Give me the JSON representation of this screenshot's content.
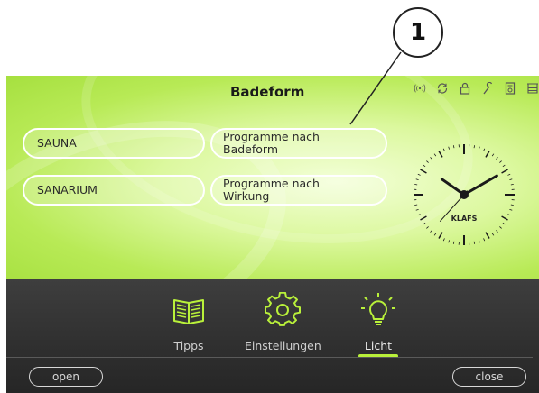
{
  "callout": {
    "number": "1"
  },
  "screen": {
    "title": "Badeform",
    "status_icons": [
      "wireless-icon",
      "refresh-icon",
      "lock-icon",
      "wrench-icon",
      "device-icon",
      "stack-icon"
    ],
    "buttons": [
      {
        "label": "SAUNA"
      },
      {
        "label_line1": "Programme nach",
        "label_line2": "Badeform"
      },
      {
        "label": "SANARIUM"
      },
      {
        "label_line1": "Programme nach",
        "label_line2": "Wirkung"
      }
    ],
    "clock": {
      "brand": "KLAFS",
      "hour": 10,
      "minute": 10,
      "second": 37
    }
  },
  "nav": {
    "items": [
      {
        "label": "Tipps",
        "icon": "book-icon"
      },
      {
        "label": "Einstellungen",
        "icon": "gear-icon"
      },
      {
        "label": "Licht",
        "icon": "light-bulb-icon",
        "active": true
      }
    ]
  },
  "footer": {
    "open_label": "open",
    "close_label": "close"
  },
  "colors": {
    "accent": "#b9f13a",
    "screen_bg": "#c6ef6e",
    "bar_bg": "#333333"
  }
}
